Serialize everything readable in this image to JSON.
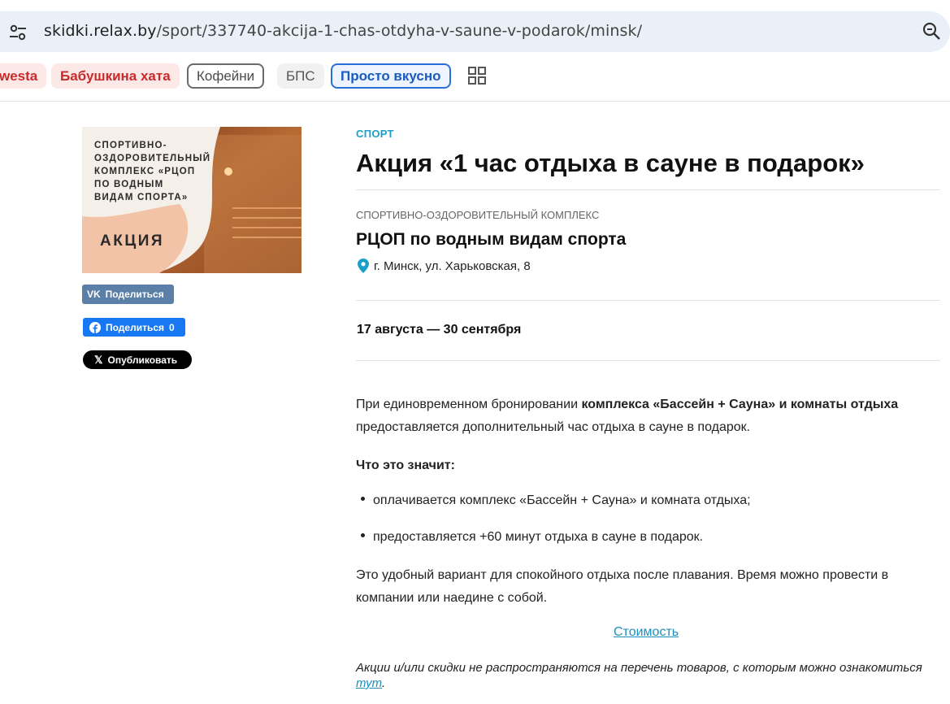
{
  "browser": {
    "url_host": "skidki.relax.by",
    "url_path": "/sport/337740-akcija-1-chas-otdyha-v-saune-v-podarok/minsk/"
  },
  "pills": [
    "westa",
    "Бабушкина хата",
    "Кофейни",
    "БПС",
    "Просто вкусно"
  ],
  "promo_image": {
    "caption": "СПОРТИВНО-ОЗДОРОВИТЕЛЬНЫЙ КОМПЛЕКС «РЦОП ПО ВОДНЫМ ВИДАМ СПОРТА»",
    "line1": "СПОРТИВНО-",
    "line2": "ОЗДОРОВИТЕЛЬНЫЙ",
    "line3": "КОМПЛЕКС «РЦОП",
    "line4": "ПО ВОДНЫМ",
    "line5": "ВИДАМ СПОРТА»",
    "badge": "АКЦИЯ"
  },
  "share": {
    "vk": "Поделиться",
    "fb": "Поделиться",
    "fb_count": "0",
    "x": "Опубликовать"
  },
  "article": {
    "category": "СПОРТ",
    "title": "Акция «1 час отдыха в сауне в подарок»",
    "org_type": "СПОРТИВНО-ОЗДОРОВИТЕЛЬНЫЙ КОМПЛЕКС",
    "org_name": "РЦОП по водным видам спорта",
    "address": "г. Минск, ул. Харьковская, 8",
    "dates": "17 августа — 30 сентября",
    "p1_a": "При единовременном бронировании ",
    "p1_b": "комплекса «Бассейн + Сауна» и комнаты отдыха",
    "p1_c": " предоставляется дополнительный час отдыха в сауне в подарок.",
    "what_title": "Что это значит:",
    "bullet1": "оплачивается комплекс «Бассейн + Сауна» и комната отдыха;",
    "bullet2": "предоставляется +60 минут отдыха в сауне в подарок.",
    "p3": "Это удобный вариант для спокойного отдыха после плавания. Время можно провести в компании или наедине с собой.",
    "cost_link": "Стоимость",
    "note_a": "Акции и/или скидки не распространяются на перечень товаров, с которым можно ознакомиться ",
    "note_link": "тут",
    "note_b": "."
  }
}
